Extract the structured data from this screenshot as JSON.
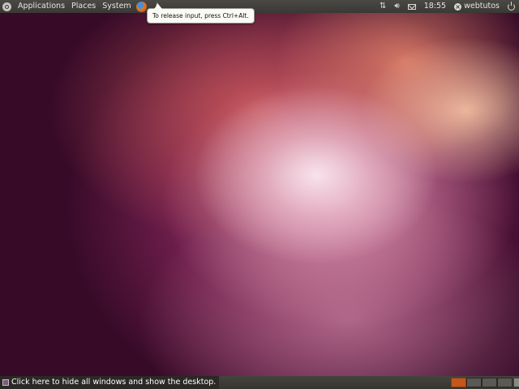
{
  "top_panel": {
    "menus": [
      "Applications",
      "Places",
      "System"
    ],
    "tray": {
      "time": "18:55",
      "user": "webtutos"
    }
  },
  "tooltip": {
    "text": "To release input, press Ctrl+Alt."
  },
  "bottom_panel": {
    "show_desktop_label": "Click here to hide all windows and show the desktop.",
    "workspaces": [
      {
        "active": true
      },
      {
        "active": false
      },
      {
        "active": false
      },
      {
        "active": false
      }
    ]
  },
  "icons": {
    "ubuntu_logo": "ubuntu-logo-icon",
    "browser": "firefox-icon",
    "network": "network-arrows-icon",
    "volume": "speaker-icon",
    "mail": "envelope-icon",
    "session": "close-x-icon",
    "power": "power-icon",
    "show_desktop": "show-desktop-icon"
  },
  "colors": {
    "panel": "#3a3935",
    "active_workspace": "#c4571e",
    "tooltip_bg": "#fbfbf5"
  }
}
